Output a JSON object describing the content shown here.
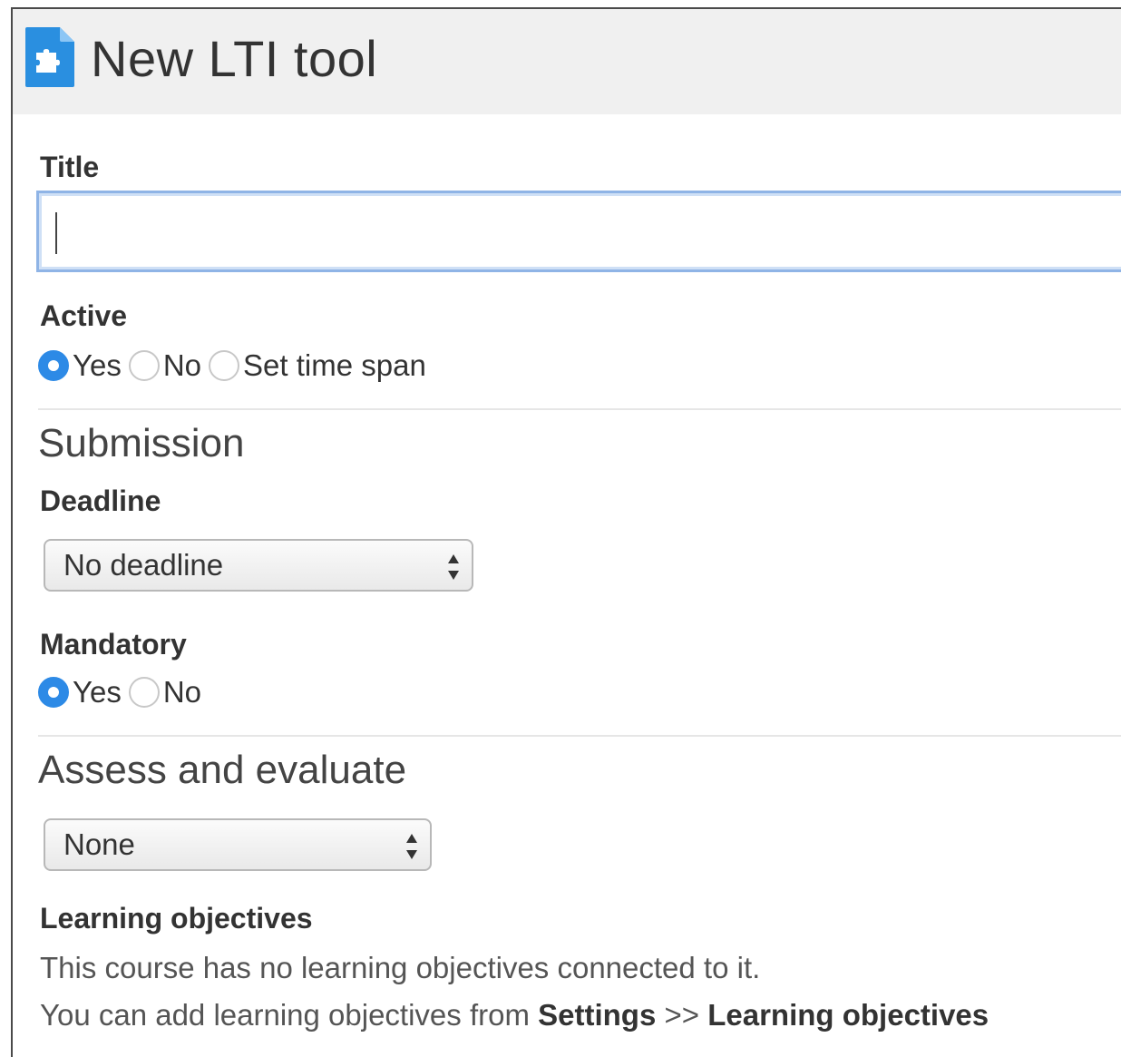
{
  "header": {
    "title": "New LTI tool",
    "icon": "puzzle-piece-document-icon",
    "icon_color": "#2a8fe0"
  },
  "form": {
    "title_label": "Title",
    "title_value": "",
    "active": {
      "label": "Active",
      "options": [
        "Yes",
        "No",
        "Set time span"
      ],
      "selected": "Yes"
    },
    "submission": {
      "heading": "Submission",
      "deadline_label": "Deadline",
      "deadline_value": "No deadline",
      "mandatory": {
        "label": "Mandatory",
        "options": [
          "Yes",
          "No"
        ],
        "selected": "Yes"
      }
    },
    "assess": {
      "heading": "Assess and evaluate",
      "value": "None"
    },
    "learning_objectives": {
      "label": "Learning objectives",
      "line1": "This course has no learning objectives connected to it.",
      "line2_prefix": "You can add learning objectives from",
      "line2_settings": "Settings",
      "line2_sep": ">>",
      "line2_target": "Learning objectives"
    }
  },
  "colors": {
    "accent": "#2d8ae6",
    "focus_border": "#8fb4e6"
  }
}
